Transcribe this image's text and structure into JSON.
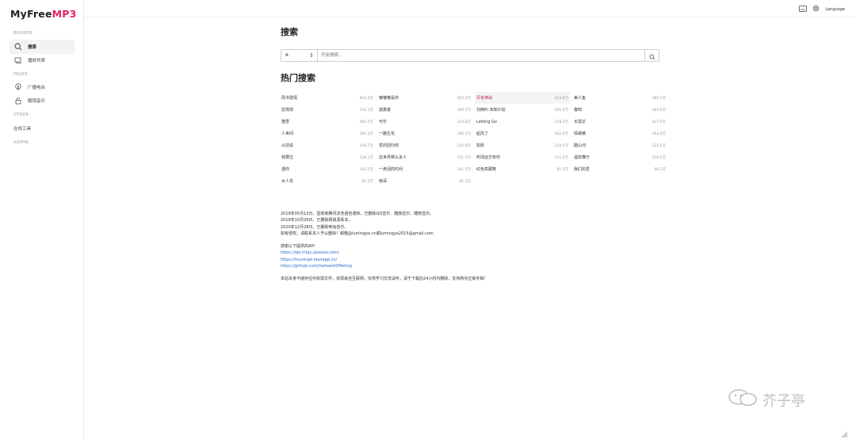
{
  "brand": {
    "name_prefix": "MyFree",
    "name_accent": "MP3",
    "accent_color": "#e0245e"
  },
  "sidebar": {
    "browse_label": "BROWSE",
    "items": [
      {
        "label": "搜索",
        "icon": "search-icon"
      },
      {
        "label": "播放列表",
        "icon": "playlist-icon"
      }
    ],
    "pages_label": "PAGES",
    "pages": [
      {
        "label": "广播电台",
        "icon": "radio-icon"
      },
      {
        "label": "解锁音乐",
        "icon": "unlock-icon"
      }
    ],
    "other_label": "OTHER",
    "other": [
      {
        "label": "在线工具"
      }
    ],
    "admin_label": "ADMIN"
  },
  "header": {
    "language_label": "Language"
  },
  "search": {
    "title": "搜索",
    "source_value": "A",
    "placeholder": "开始搜索..."
  },
  "hot": {
    "title": "热门搜索",
    "items": [
      {
        "name": "周书雷情",
        "count": "805.4万"
      },
      {
        "name": "嘟嘟嘟是你",
        "count": "565.2万"
      },
      {
        "name": "丹雀神战",
        "count": "423.8万",
        "highlight": true
      },
      {
        "name": "美人鱼",
        "count": "395.5万"
      },
      {
        "name": "剪地球",
        "count": "334.1万"
      },
      {
        "name": "孤勇者",
        "count": "306.5万"
      },
      {
        "name": "刘两叭·未知计划",
        "count": "291.6万"
      },
      {
        "name": "春田",
        "count": "283.8万"
      },
      {
        "name": "猫雪",
        "count": "260.5万"
      },
      {
        "name": "可乐",
        "count": "234.8万"
      },
      {
        "name": "Letting Go",
        "count": "228.5万"
      },
      {
        "name": "水雷达",
        "count": "217.0万"
      },
      {
        "name": "人世间",
        "count": "185.0万"
      },
      {
        "name": "一路生花",
        "count": "185.1万"
      },
      {
        "name": "起风了",
        "count": "182.6万"
      },
      {
        "name": "情歌精",
        "count": "164.4万"
      },
      {
        "name": "从前说",
        "count": "144.7万"
      },
      {
        "name": "爱的回归线",
        "count": "142.8万"
      },
      {
        "name": "如愿",
        "count": "134.5万"
      },
      {
        "name": "踏山河",
        "count": "121.5万"
      },
      {
        "name": "我要过",
        "count": "128.1万"
      },
      {
        "name": "这世界那么多人",
        "count": "121.5万"
      },
      {
        "name": "听闻远方有你",
        "count": "111.5万"
      },
      {
        "name": "温泉舞厅",
        "count": "110.5万"
      },
      {
        "name": "遇你",
        "count": "103.2万"
      },
      {
        "name": "一滴泪的时间",
        "count": "101.5万"
      },
      {
        "name": "红色高跟鞋",
        "count": "91.2万"
      },
      {
        "name": "我们的爱",
        "count": "96.2万"
      },
      {
        "name": "女人花",
        "count": "83.5万"
      },
      {
        "name": "雨深",
        "count": "81.3万"
      }
    ]
  },
  "notice": {
    "lines": [
      "2019年05月13日，因收到腾讯法务函告通知，已删除QQ音乐、酷我音乐、酷狗音乐。",
      "2019年10月29日，已删除网易源系本。",
      "2020年12月28日，已删除咪咕音乐。",
      "如有侵权，请联系本人予以删除！邮箱@lumingye.cn或lumingye2015@gmail.com"
    ],
    "thanks": "感谢以下提供的API",
    "links": [
      "https://api.mlgu.jsososo.com/",
      "https://musicapi.leanapp.cn/",
      "https://github.com/metowolf/Meting"
    ],
    "footer": "本站本身不储存任何资源文件，资源来自互联网，仅供学习交流试听，请于下载后24小时内删除，支持购买正版专辑！"
  },
  "watermark": {
    "text": "芥子亭"
  }
}
